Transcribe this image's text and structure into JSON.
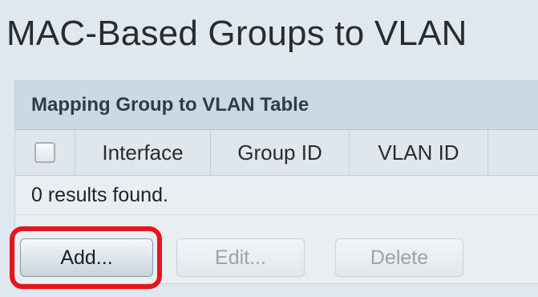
{
  "page": {
    "title": "MAC-Based Groups to VLAN"
  },
  "table": {
    "title": "Mapping Group to VLAN Table",
    "columns": [
      "Interface",
      "Group ID",
      "VLAN ID"
    ],
    "rows": [],
    "results_text": "0 results found."
  },
  "buttons": {
    "add": "Add...",
    "edit": "Edit...",
    "delete": "Delete"
  },
  "colors": {
    "highlight": "#e8141c"
  }
}
